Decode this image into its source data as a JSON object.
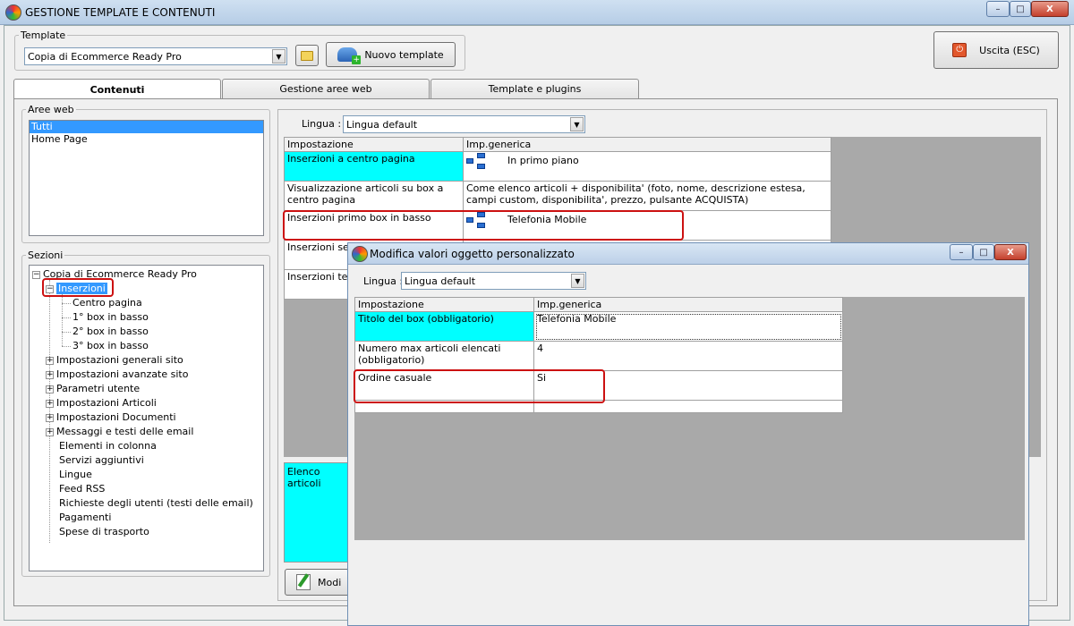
{
  "window": {
    "title": "GESTIONE TEMPLATE E CONTENUTI",
    "min": "–",
    "max": "□",
    "close": "X"
  },
  "template": {
    "legend": "Template",
    "selected": "Copia di Ecommerce Ready Pro",
    "new_label": "Nuovo template"
  },
  "exit_label": "Uscita (ESC)",
  "tabs": [
    {
      "label": "Contenuti"
    },
    {
      "label": "Gestione aree web"
    },
    {
      "label": "Template e plugins"
    }
  ],
  "aree_web": {
    "legend": "Aree web",
    "items": [
      "Tutti",
      "Home Page"
    ]
  },
  "sezioni": {
    "legend": "Sezioni",
    "root": "Copia di Ecommerce Ready Pro",
    "inserzioni": "Inserzioni",
    "sub": [
      "Centro pagina",
      "1° box in basso",
      "2° box in basso",
      "3° box in basso"
    ],
    "expandable": [
      "Impostazioni generali sito",
      "Impostazioni avanzate sito",
      "Parametri utente",
      "Impostazioni Articoli",
      "Impostazioni Documenti",
      "Messaggi e testi delle email"
    ],
    "leaves": [
      "Elementi in colonna",
      "Servizi aggiuntivi",
      "Lingue",
      "Feed RSS",
      "Richieste degli utenti (testi delle email)",
      "Pagamenti",
      "Spese di trasporto"
    ]
  },
  "main": {
    "lingua_label": "Lingua :",
    "lingua_value": "Lingua default",
    "headers": [
      "Impostazione",
      "Imp.generica"
    ],
    "rows": [
      {
        "name": "Inserzioni a centro pagina",
        "value": "In primo piano"
      },
      {
        "name": "Visualizzazione articoli su box a centro pagina",
        "value": "Come elenco articoli + disponibilita' (foto, nome, descrizione estesa, campi custom, disponibilita', prezzo, pulsante ACQUISTA)"
      },
      {
        "name": "Inserzioni primo box in basso",
        "value": "Telefonia Mobile"
      },
      {
        "name": "Inserzioni sec",
        "value": ""
      },
      {
        "name": "Inserzioni terz",
        "value": ""
      }
    ],
    "desc_text": "Elenco articoli",
    "modify_label": "Modi"
  },
  "dialog": {
    "title": "Modifica valori oggetto personalizzato",
    "lingua_label": "Lingua :",
    "lingua_value": "Lingua default",
    "headers": [
      "Impostazione",
      "Imp.generica"
    ],
    "rows": [
      {
        "name": "Titolo del box (obbligatorio)",
        "value": "Telefonia Mobile"
      },
      {
        "name": "Numero max articoli elencati (obbligatorio)",
        "value": "4"
      },
      {
        "name": "Ordine casuale",
        "value": "Si"
      }
    ]
  }
}
